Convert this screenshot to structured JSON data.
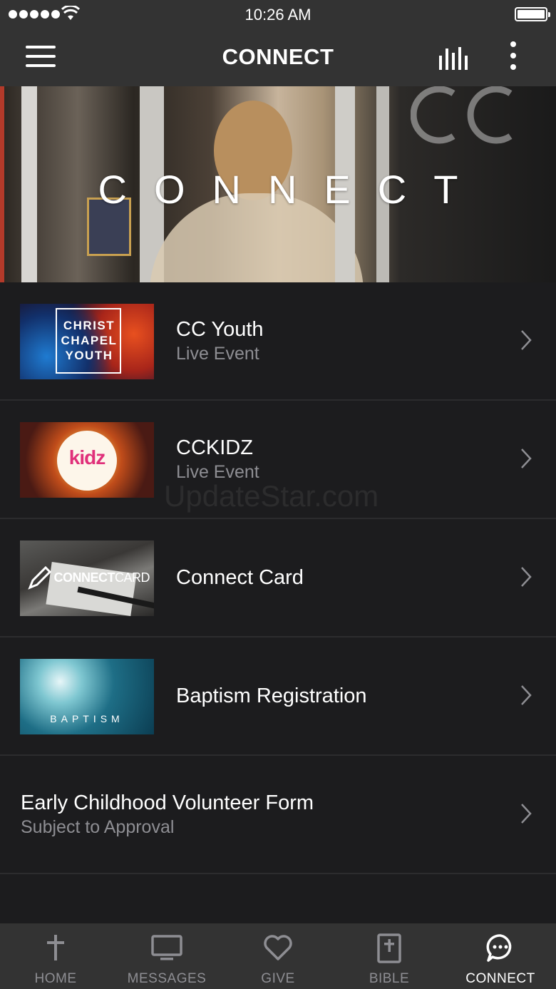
{
  "status_bar": {
    "time": "10:26 AM"
  },
  "nav": {
    "title": "CONNECT"
  },
  "hero": {
    "title": "CONNECT"
  },
  "list": [
    {
      "title": "CC Youth",
      "subtitle": "Live Event",
      "thumb_text": "CHRIST CHAPEL YOUTH",
      "thumb_icon": "youth-thumbnail"
    },
    {
      "title": "CCKIDZ",
      "subtitle": "Live Event",
      "thumb_text": "kidz",
      "thumb_icon": "kidz-thumbnail"
    },
    {
      "title": "Connect Card",
      "subtitle": "",
      "thumb_text_bold": "CONNECT",
      "thumb_text_light": "CARD",
      "thumb_icon": "connect-card-thumbnail"
    },
    {
      "title": "Baptism Registration",
      "subtitle": "",
      "thumb_text": "BAPTISM",
      "thumb_icon": "baptism-thumbnail"
    },
    {
      "title": "Early Childhood Volunteer Form",
      "subtitle": "Subject to Approval"
    }
  ],
  "watermark": "UpdateStar.com",
  "tabs": [
    {
      "label": "HOME",
      "icon": "cross-icon",
      "active": false
    },
    {
      "label": "MESSAGES",
      "icon": "monitor-icon",
      "active": false
    },
    {
      "label": "GIVE",
      "icon": "heart-icon",
      "active": false
    },
    {
      "label": "BIBLE",
      "icon": "bible-icon",
      "active": false
    },
    {
      "label": "CONNECT",
      "icon": "chat-bubble-icon",
      "active": true
    }
  ],
  "colors": {
    "bar_bg": "#333333",
    "page_bg": "#1c1c1e",
    "divider": "#2c2c2e",
    "muted_text": "#8e8e93",
    "active_text": "#ffffff"
  }
}
